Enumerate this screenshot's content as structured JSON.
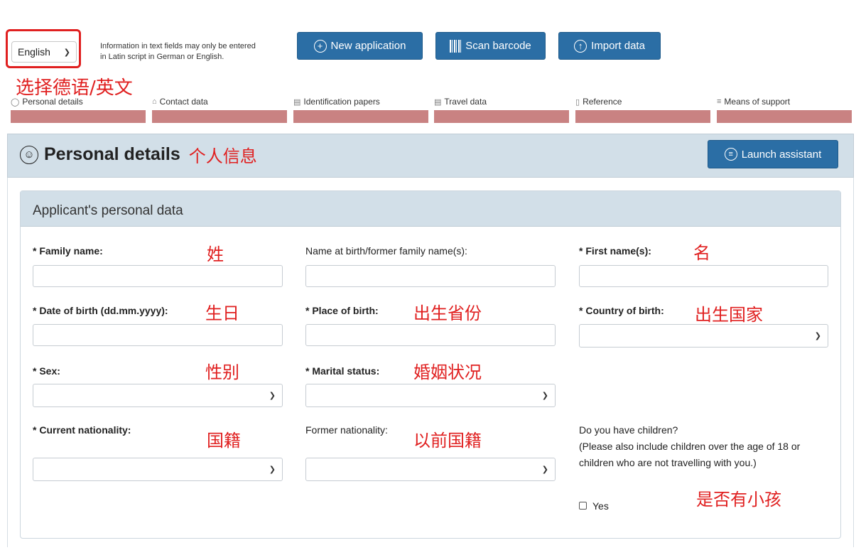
{
  "language": {
    "selected": "English",
    "note": "Information in text fields may only be entered in Latin script in German or English.",
    "annotation": "选择德语/英文"
  },
  "top_buttons": {
    "new_application": "New application",
    "scan_barcode": "Scan barcode",
    "import_data": "Import data"
  },
  "steps": [
    {
      "label": "Personal details",
      "icon": "person-icon"
    },
    {
      "label": "Contact data",
      "icon": "house-icon"
    },
    {
      "label": "Identification papers",
      "icon": "id-card-icon"
    },
    {
      "label": "Travel data",
      "icon": "luggage-icon"
    },
    {
      "label": "Reference",
      "icon": "document-icon"
    },
    {
      "label": "Means of support",
      "icon": "money-icon"
    }
  ],
  "section": {
    "title": "Personal details",
    "annotation": "个人信息",
    "assistant_button": "Launch assistant"
  },
  "card": {
    "title": "Applicant's personal data"
  },
  "fields": {
    "family_name": {
      "label": "* Family name:",
      "annotation": "姓"
    },
    "birth_name": {
      "label": "Name at birth/former family name(s):"
    },
    "first_name": {
      "label": "* First name(s):",
      "annotation": "名"
    },
    "date_of_birth": {
      "label": "* Date of birth (dd.mm.yyyy):",
      "annotation": "生日"
    },
    "place_of_birth": {
      "label": "* Place of birth:",
      "annotation": "出生省份"
    },
    "country_of_birth": {
      "label": "* Country of birth:",
      "annotation": "出生国家"
    },
    "sex": {
      "label": "* Sex:",
      "annotation": "性别"
    },
    "marital_status": {
      "label": "* Marital status:",
      "annotation": "婚姻状况"
    },
    "current_nationality": {
      "label": "* Current nationality:",
      "annotation": "国籍"
    },
    "former_nationality": {
      "label": "Former nationality:",
      "annotation": "以前国籍"
    },
    "children": {
      "question": "Do you have children?",
      "note": "(Please also include children over the age of 18 or children who are not travelling with you.)",
      "checkbox_label": "Yes",
      "annotation": "是否有小孩"
    }
  },
  "colors": {
    "primary": "#2b6ea5",
    "header_bg": "#d2dfe8",
    "annotation": "#e02020",
    "step_bar": "#c98282"
  }
}
